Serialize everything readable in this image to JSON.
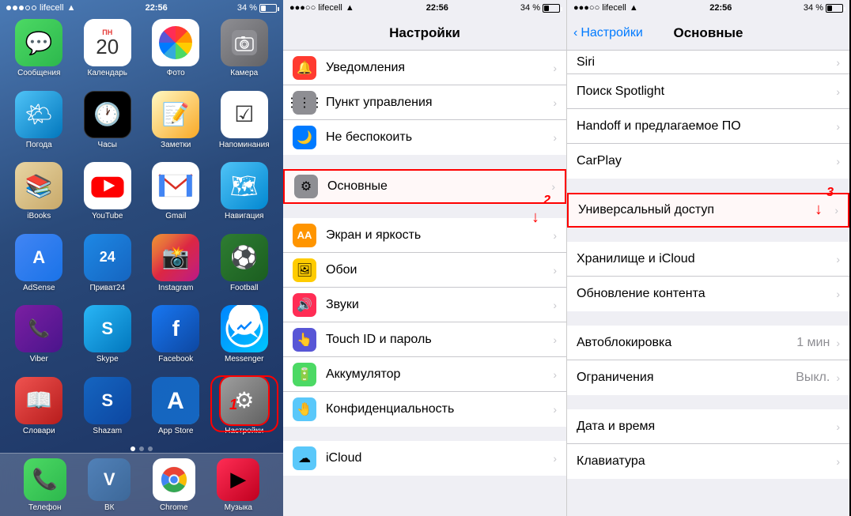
{
  "phone1": {
    "status": {
      "carrier": "lifecell",
      "time": "22:56",
      "battery": "34 %"
    },
    "apps": [
      {
        "id": "messages",
        "label": "Сообщения",
        "icon": "💬",
        "color": "icon-messages"
      },
      {
        "id": "calendar",
        "label": "Календарь",
        "icon": "cal",
        "color": "icon-calendar"
      },
      {
        "id": "photos",
        "label": "Фото",
        "icon": "photos",
        "color": "icon-photos"
      },
      {
        "id": "camera",
        "label": "Камера",
        "icon": "📷",
        "color": "icon-camera"
      },
      {
        "id": "weather",
        "label": "Погода",
        "icon": "🌤",
        "color": "icon-weather"
      },
      {
        "id": "clock",
        "label": "Часы",
        "icon": "🕐",
        "color": "icon-clock"
      },
      {
        "id": "notes",
        "label": "Заметки",
        "icon": "📝",
        "color": "icon-notes"
      },
      {
        "id": "reminders",
        "label": "Напоминания",
        "icon": "☑",
        "color": "icon-reminders"
      },
      {
        "id": "ibooks",
        "label": "iBooks",
        "icon": "📚",
        "color": "icon-ibooks"
      },
      {
        "id": "youtube",
        "label": "YouTube",
        "icon": "yt",
        "color": "icon-youtube"
      },
      {
        "id": "gmail",
        "label": "Gmail",
        "icon": "✉",
        "color": "icon-gmail"
      },
      {
        "id": "navigation",
        "label": "Навигация",
        "icon": "🗺",
        "color": "icon-navigation"
      },
      {
        "id": "adsense",
        "label": "AdSense",
        "icon": "A",
        "color": "icon-adsense"
      },
      {
        "id": "privat24",
        "label": "Приват24",
        "icon": "24",
        "color": "icon-privat24"
      },
      {
        "id": "instagram",
        "label": "Instagram",
        "icon": "📸",
        "color": "icon-instagram"
      },
      {
        "id": "football",
        "label": "Football",
        "icon": "⚽",
        "color": "icon-football"
      },
      {
        "id": "viber",
        "label": "Viber",
        "icon": "📞",
        "color": "icon-viber"
      },
      {
        "id": "skype",
        "label": "Skype",
        "icon": "S",
        "color": "icon-skype"
      },
      {
        "id": "facebook",
        "label": "Facebook",
        "icon": "f",
        "color": "icon-facebook"
      },
      {
        "id": "messenger",
        "label": "Messenger",
        "icon": "✈",
        "color": "icon-messenger"
      },
      {
        "id": "slovari",
        "label": "Словари",
        "icon": "📖",
        "color": "icon-slovari"
      },
      {
        "id": "shazam",
        "label": "Shazam",
        "icon": "S",
        "color": "icon-shazam"
      },
      {
        "id": "appstore",
        "label": "App Store",
        "icon": "A",
        "color": "icon-appstore"
      },
      {
        "id": "settings",
        "label": "Настройки",
        "icon": "⚙",
        "color": "icon-settings"
      }
    ],
    "dock": [
      {
        "id": "phone",
        "label": "Телефон",
        "icon": "📞",
        "color": "icon-phone"
      },
      {
        "id": "vk",
        "label": "ВК",
        "icon": "V",
        "color": "icon-vk"
      },
      {
        "id": "chrome",
        "label": "Chrome",
        "icon": "chrome",
        "color": "icon-chrome"
      },
      {
        "id": "music",
        "label": "Музыка",
        "icon": "🎵",
        "color": "icon-music"
      }
    ]
  },
  "phone2": {
    "status": {
      "carrier": "lifecell",
      "time": "22:56",
      "battery": "34 %"
    },
    "title": "Настройки",
    "rows": [
      {
        "id": "uved",
        "icon": "🔔",
        "iconColor": "si-red",
        "label": "Уведомления"
      },
      {
        "id": "punkt",
        "icon": "⚙",
        "iconColor": "si-gray",
        "label": "Пункт управления"
      },
      {
        "id": "notdisturb",
        "icon": "🌙",
        "iconColor": "si-blue",
        "label": "Не беспокоить"
      },
      {
        "id": "osnov",
        "icon": "⚙",
        "iconColor": "si-gear",
        "label": "Основные",
        "highlighted": true
      },
      {
        "id": "screen",
        "icon": "AA",
        "iconColor": "si-orange",
        "label": "Экран и яркость"
      },
      {
        "id": "wallpaper",
        "icon": "🖼",
        "iconColor": "si-yellow",
        "label": "Обои"
      },
      {
        "id": "sounds",
        "icon": "🔊",
        "iconColor": "si-pink",
        "label": "Звуки"
      },
      {
        "id": "touchid",
        "icon": "👆",
        "iconColor": "si-purple",
        "label": "Touch ID и пароль"
      },
      {
        "id": "battery",
        "icon": "🔋",
        "iconColor": "si-green",
        "label": "Аккумулятор"
      },
      {
        "id": "privacy",
        "icon": "🤚",
        "iconColor": "si-lightblue",
        "label": "Конфиденциальность"
      },
      {
        "id": "icloud",
        "icon": "☁",
        "iconColor": "si-lightblue",
        "label": "iCloud"
      }
    ],
    "annotation": "2"
  },
  "phone3": {
    "status": {
      "carrier": "lifecell",
      "time": "22:56",
      "battery": "34 %"
    },
    "back_label": "Настройки",
    "title": "Основные",
    "rows": [
      {
        "id": "siri",
        "label": "Siri",
        "value": ""
      },
      {
        "id": "spotlight",
        "label": "Поиск Spotlight",
        "value": ""
      },
      {
        "id": "handoff",
        "label": "Handoff и предлагаемое ПО",
        "value": ""
      },
      {
        "id": "carplay",
        "label": "CarPlay",
        "value": ""
      },
      {
        "id": "univdostup",
        "label": "Универсальный доступ",
        "value": "",
        "highlighted": true
      },
      {
        "id": "hranilish",
        "label": "Хранилище и iCloud",
        "value": ""
      },
      {
        "id": "obnovlenie",
        "label": "Обновление контента",
        "value": ""
      },
      {
        "id": "autoblokirovka",
        "label": "Автоблокировка",
        "value": "1 мин"
      },
      {
        "id": "ogranich",
        "label": "Ограничения",
        "value": "Выкл."
      },
      {
        "id": "data",
        "label": "Дата и время",
        "value": ""
      },
      {
        "id": "klaviatura",
        "label": "Клавиатура",
        "value": ""
      }
    ],
    "annotation": "3"
  }
}
